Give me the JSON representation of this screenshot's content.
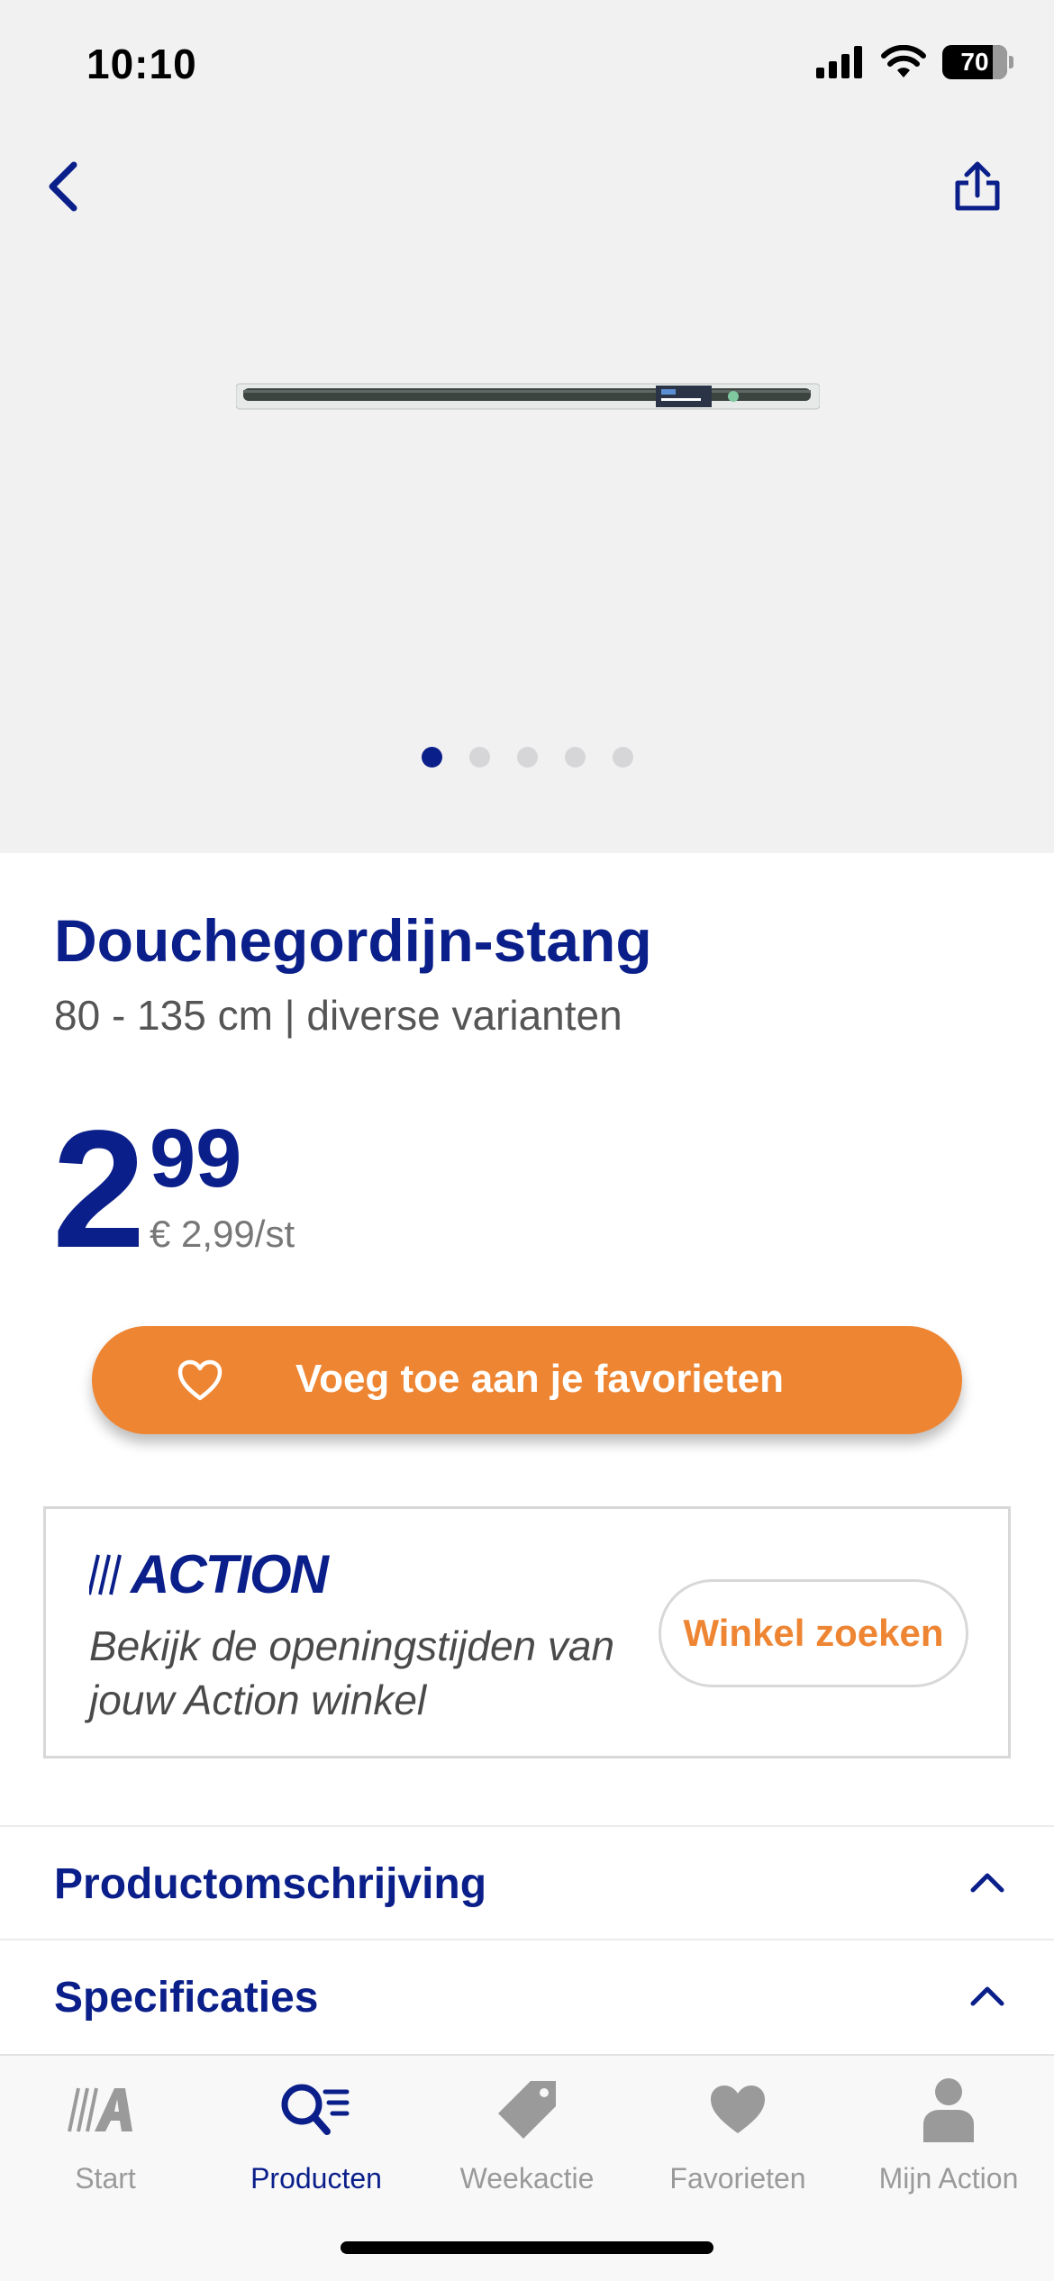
{
  "status_bar": {
    "time": "10:10",
    "battery": "70"
  },
  "product": {
    "title": "Douchegordijn-stang",
    "subtitle": "80 - 135 cm | diverse varianten",
    "price_whole": "2",
    "price_cents": "99",
    "unit_price": "€ 2,99/st",
    "image_count": 5,
    "active_image": 1
  },
  "favorite_button": {
    "label": "Voeg toe aan je favorieten"
  },
  "store_box": {
    "logo": "ACTION",
    "text": "Bekijk de openingstijden van jouw Action winkel",
    "button": "Winkel zoeken"
  },
  "sections": [
    {
      "label": "Productomschrijving"
    },
    {
      "label": "Specificaties"
    }
  ],
  "tabbar": {
    "tabs": [
      {
        "label": "Start",
        "icon": "action-logo-icon"
      },
      {
        "label": "Producten",
        "icon": "search-list-icon"
      },
      {
        "label": "Weekactie",
        "icon": "tag-icon"
      },
      {
        "label": "Favorieten",
        "icon": "heart-icon"
      },
      {
        "label": "Mijn Action",
        "icon": "user-icon"
      }
    ],
    "active": "Producten"
  },
  "colors": {
    "brand": "#0b1f8a",
    "accent": "#ee8533",
    "hero_bg": "#f1f1f2"
  }
}
